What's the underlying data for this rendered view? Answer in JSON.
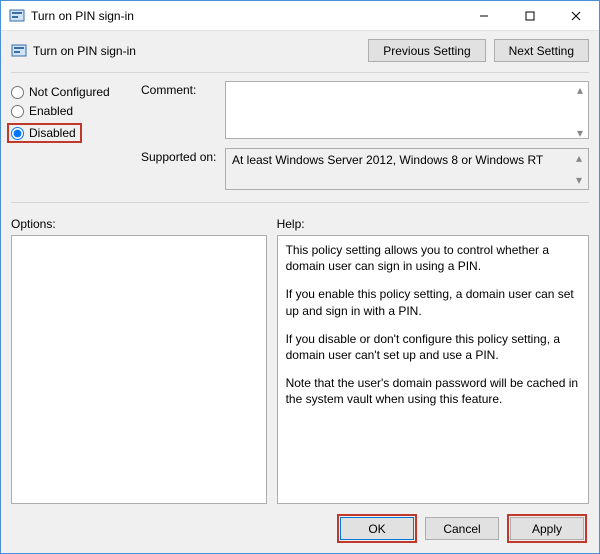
{
  "window": {
    "title": "Turn on PIN sign-in",
    "minimize_aria": "Minimize",
    "maximize_aria": "Maximize",
    "close_aria": "Close"
  },
  "header": {
    "title": "Turn on PIN sign-in",
    "previous_label": "Previous Setting",
    "next_label": "Next Setting"
  },
  "radios": {
    "not_configured": "Not Configured",
    "enabled": "Enabled",
    "disabled": "Disabled",
    "selected": "disabled"
  },
  "fields": {
    "comment_label": "Comment:",
    "comment_value": "",
    "supported_label": "Supported on:",
    "supported_value": "At least Windows Server 2012, Windows 8 or Windows RT"
  },
  "lower": {
    "options_label": "Options:",
    "help_label": "Help:",
    "help_paragraphs": [
      "This policy setting allows you to control whether a domain user can sign in using a PIN.",
      "If you enable this policy setting, a domain user can set up and sign in with a PIN.",
      "If you disable or don't configure this policy setting, a domain user can't set up and use a PIN.",
      "Note that the user's domain password will be cached in the system vault when using this feature."
    ]
  },
  "footer": {
    "ok": "OK",
    "cancel": "Cancel",
    "apply": "Apply"
  }
}
